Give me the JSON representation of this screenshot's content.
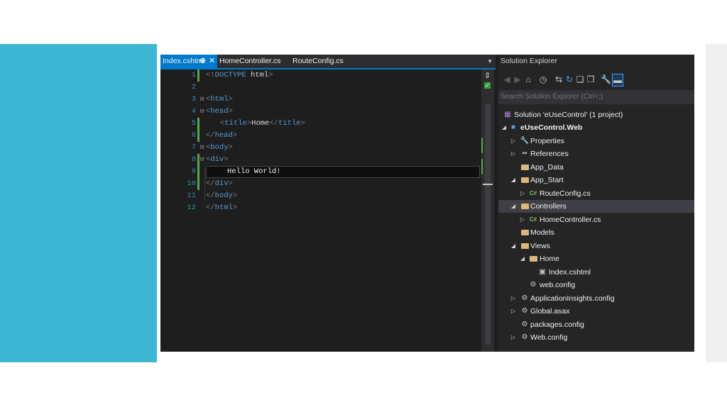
{
  "editor": {
    "tabs": [
      {
        "label": "Index.cshtml",
        "active": true
      },
      {
        "label": "HomeController.cs",
        "active": false
      },
      {
        "label": "RouteConfig.cs",
        "active": false
      }
    ],
    "pin_icon": "pin-icon",
    "close_icon": "close-icon",
    "lines": [
      {
        "num": "1",
        "text": "<!DOCTYPE html>"
      },
      {
        "num": "2",
        "text": ""
      },
      {
        "num": "3",
        "text": "<html>"
      },
      {
        "num": "4",
        "text": "<head>"
      },
      {
        "num": "5",
        "text": "<title>Home</title>"
      },
      {
        "num": "6",
        "text": "</head>"
      },
      {
        "num": "7",
        "text": "<body>"
      },
      {
        "num": "8",
        "text": "<div>"
      },
      {
        "num": "9",
        "text": "Hello World!"
      },
      {
        "num": "10",
        "text": "</div>"
      },
      {
        "num": "11",
        "text": "</body>"
      },
      {
        "num": "12",
        "text": "</html>"
      }
    ]
  },
  "solution_explorer": {
    "title": "Solution Explorer",
    "search_placeholder": "Search Solution Explorer (Ctrl+;)",
    "toolbar_icons": [
      "back-icon",
      "forward-icon",
      "home-icon",
      "history-icon",
      "sync-icon",
      "refresh-icon",
      "collapse-all-icon",
      "show-all-files-icon",
      "properties-wrench-icon",
      "preview-icon"
    ],
    "tree": [
      {
        "label": "Solution 'eUseControl' (1 project)",
        "icon": "solution-icon",
        "expander": ""
      },
      {
        "label": "eUseControl.Web",
        "icon": "web-project-icon",
        "expander": "expanded",
        "bold": true
      },
      {
        "label": "Properties",
        "icon": "wrench-icon",
        "expander": "collapsed"
      },
      {
        "label": "References",
        "icon": "references-icon",
        "expander": "collapsed"
      },
      {
        "label": "App_Data",
        "icon": "folder-icon",
        "expander": ""
      },
      {
        "label": "App_Start",
        "icon": "folder-open-icon",
        "expander": "expanded"
      },
      {
        "label": "RouteConfig.cs",
        "icon": "csharp-file-icon",
        "expander": "collapsed"
      },
      {
        "label": "Controllers",
        "icon": "folder-open-icon",
        "expander": "expanded",
        "selected": true
      },
      {
        "label": "HomeController.cs",
        "icon": "csharp-file-icon",
        "expander": "collapsed"
      },
      {
        "label": "Models",
        "icon": "folder-icon",
        "expander": ""
      },
      {
        "label": "Views",
        "icon": "folder-open-icon",
        "expander": "expanded"
      },
      {
        "label": "Home",
        "icon": "folder-open-icon",
        "expander": "expanded"
      },
      {
        "label": "Index.cshtml",
        "icon": "razor-file-icon",
        "expander": ""
      },
      {
        "label": "web.config",
        "icon": "config-file-icon",
        "expander": ""
      },
      {
        "label": "ApplicationInsights.config",
        "icon": "config-file-icon",
        "expander": "collapsed"
      },
      {
        "label": "Global.asax",
        "icon": "asax-file-icon",
        "expander": "collapsed"
      },
      {
        "label": "packages.config",
        "icon": "config-file-icon",
        "expander": ""
      },
      {
        "label": "Web.config",
        "icon": "config-file-icon",
        "expander": "collapsed"
      }
    ]
  },
  "colors": {
    "slide_accent": "#3db6d4",
    "vs_blue": "#007acc",
    "editor_bg": "#1e1e1e",
    "line_number": "#2b91af",
    "tag_name": "#569cd6"
  }
}
